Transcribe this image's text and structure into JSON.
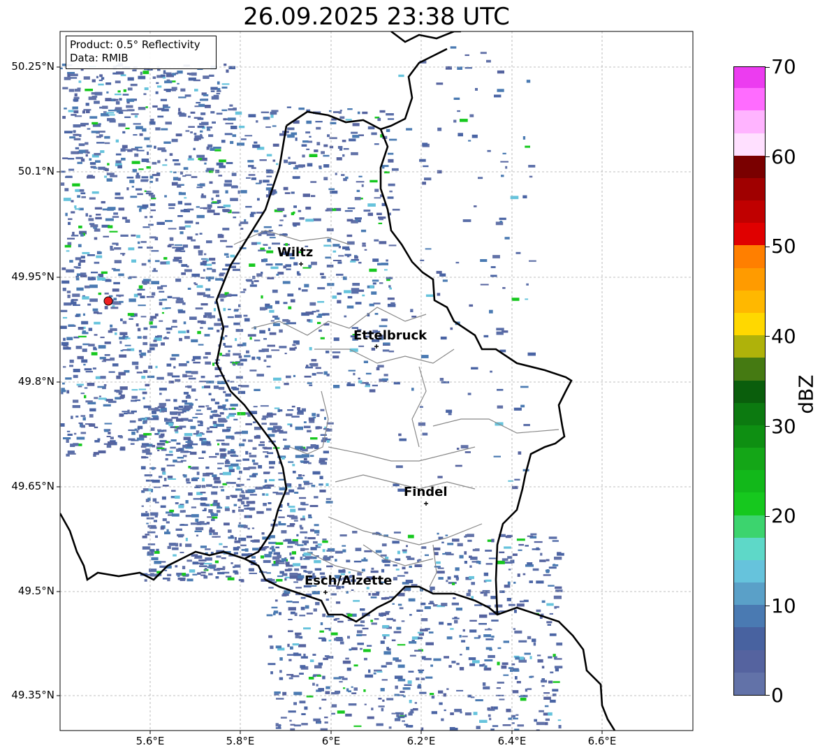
{
  "title": "26.09.2025 23:38 UTC",
  "info_box": {
    "product": "Product: 0.5° Reflectivity",
    "data": "Data: RMIB"
  },
  "map": {
    "lat_labels": [
      "50.25°N",
      "50.1°N",
      "49.95°N",
      "49.8°N",
      "49.65°N",
      "49.5°N",
      "49.35°N"
    ],
    "lon_labels": [
      "5.6°E",
      "5.8°E",
      "6°E",
      "6.2°E",
      "6.4°E",
      "6.6°E"
    ],
    "cities": [
      {
        "name": "Wiltz"
      },
      {
        "name": "Ettelbruck"
      },
      {
        "name": "Findel"
      },
      {
        "name": "Esch/Alzette"
      }
    ]
  },
  "colorbar": {
    "label": "dBZ",
    "ticks": [
      "0",
      "10",
      "20",
      "30",
      "40",
      "50",
      "60",
      "70"
    ],
    "colors": [
      "#6272a8",
      "#55639f",
      "#4862a0",
      "#4a7ab2",
      "#5aa0c8",
      "#66c3dc",
      "#5ed8c8",
      "#3cd46e",
      "#16c81e",
      "#12b81a",
      "#14a617",
      "#0e8f12",
      "#0c7a10",
      "#0a5e0c",
      "#457a12",
      "#afb20a",
      "#ffd800",
      "#ffb800",
      "#ff9b00",
      "#ff7f00",
      "#e00000",
      "#c00000",
      "#a00000",
      "#7a0000",
      "#ffe0ff",
      "#ffb4ff",
      "#ff6cff",
      "#ec3cf0"
    ]
  }
}
